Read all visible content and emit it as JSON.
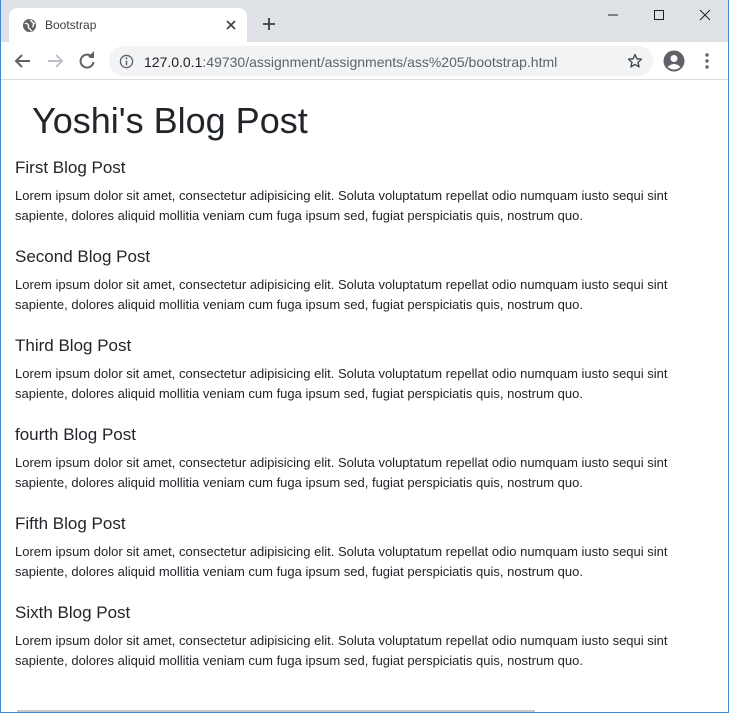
{
  "browser": {
    "tab_title": "Bootstrap",
    "url_host": "127.0.0.1",
    "url_rest": ":49730/assignment/assignments/ass%205/bootstrap.html"
  },
  "icons": {
    "favicon": "globe-icon",
    "tab_close": "close-icon",
    "new_tab": "plus-icon",
    "back": "arrow-left-icon",
    "forward": "arrow-right-icon",
    "reload": "reload-icon",
    "site_info": "info-icon",
    "bookmark": "star-icon",
    "profile": "account-icon",
    "menu": "more-vert-icon"
  },
  "page": {
    "title": "Yoshi's Blog Post",
    "posts": [
      {
        "title": "First Blog Post",
        "body": "Lorem ipsum dolor sit amet, consectetur adipisicing elit. Soluta voluptatum repellat odio numquam iusto sequi sint sapiente, dolores aliquid mollitia veniam cum fuga ipsum sed, fugiat perspiciatis quis, nostrum quo."
      },
      {
        "title": "Second Blog Post",
        "body": "Lorem ipsum dolor sit amet, consectetur adipisicing elit. Soluta voluptatum repellat odio numquam iusto sequi sint sapiente, dolores aliquid mollitia veniam cum fuga ipsum sed, fugiat perspiciatis quis, nostrum quo."
      },
      {
        "title": "Third Blog Post",
        "body": "Lorem ipsum dolor sit amet, consectetur adipisicing elit. Soluta voluptatum repellat odio numquam iusto sequi sint sapiente, dolores aliquid mollitia veniam cum fuga ipsum sed, fugiat perspiciatis quis, nostrum quo."
      },
      {
        "title": "fourth Blog Post",
        "body": "Lorem ipsum dolor sit amet, consectetur adipisicing elit. Soluta voluptatum repellat odio numquam iusto sequi sint sapiente, dolores aliquid mollitia veniam cum fuga ipsum sed, fugiat perspiciatis quis, nostrum quo."
      },
      {
        "title": "Fifth Blog Post",
        "body": "Lorem ipsum dolor sit amet, consectetur adipisicing elit. Soluta voluptatum repellat odio numquam iusto sequi sint sapiente, dolores aliquid mollitia veniam cum fuga ipsum sed, fugiat perspiciatis quis, nostrum quo."
      },
      {
        "title": "Sixth Blog Post",
        "body": "Lorem ipsum dolor sit amet, consectetur adipisicing elit. Soluta voluptatum repellat odio numquam iusto sequi sint sapiente, dolores aliquid mollitia veniam cum fuga ipsum sed, fugiat perspiciatis quis, nostrum quo."
      }
    ]
  },
  "colors": {
    "tabstrip": "#dee1e6",
    "omnibox": "#f1f3f4",
    "text": "#212529",
    "window_border": "#3c8ad6"
  }
}
